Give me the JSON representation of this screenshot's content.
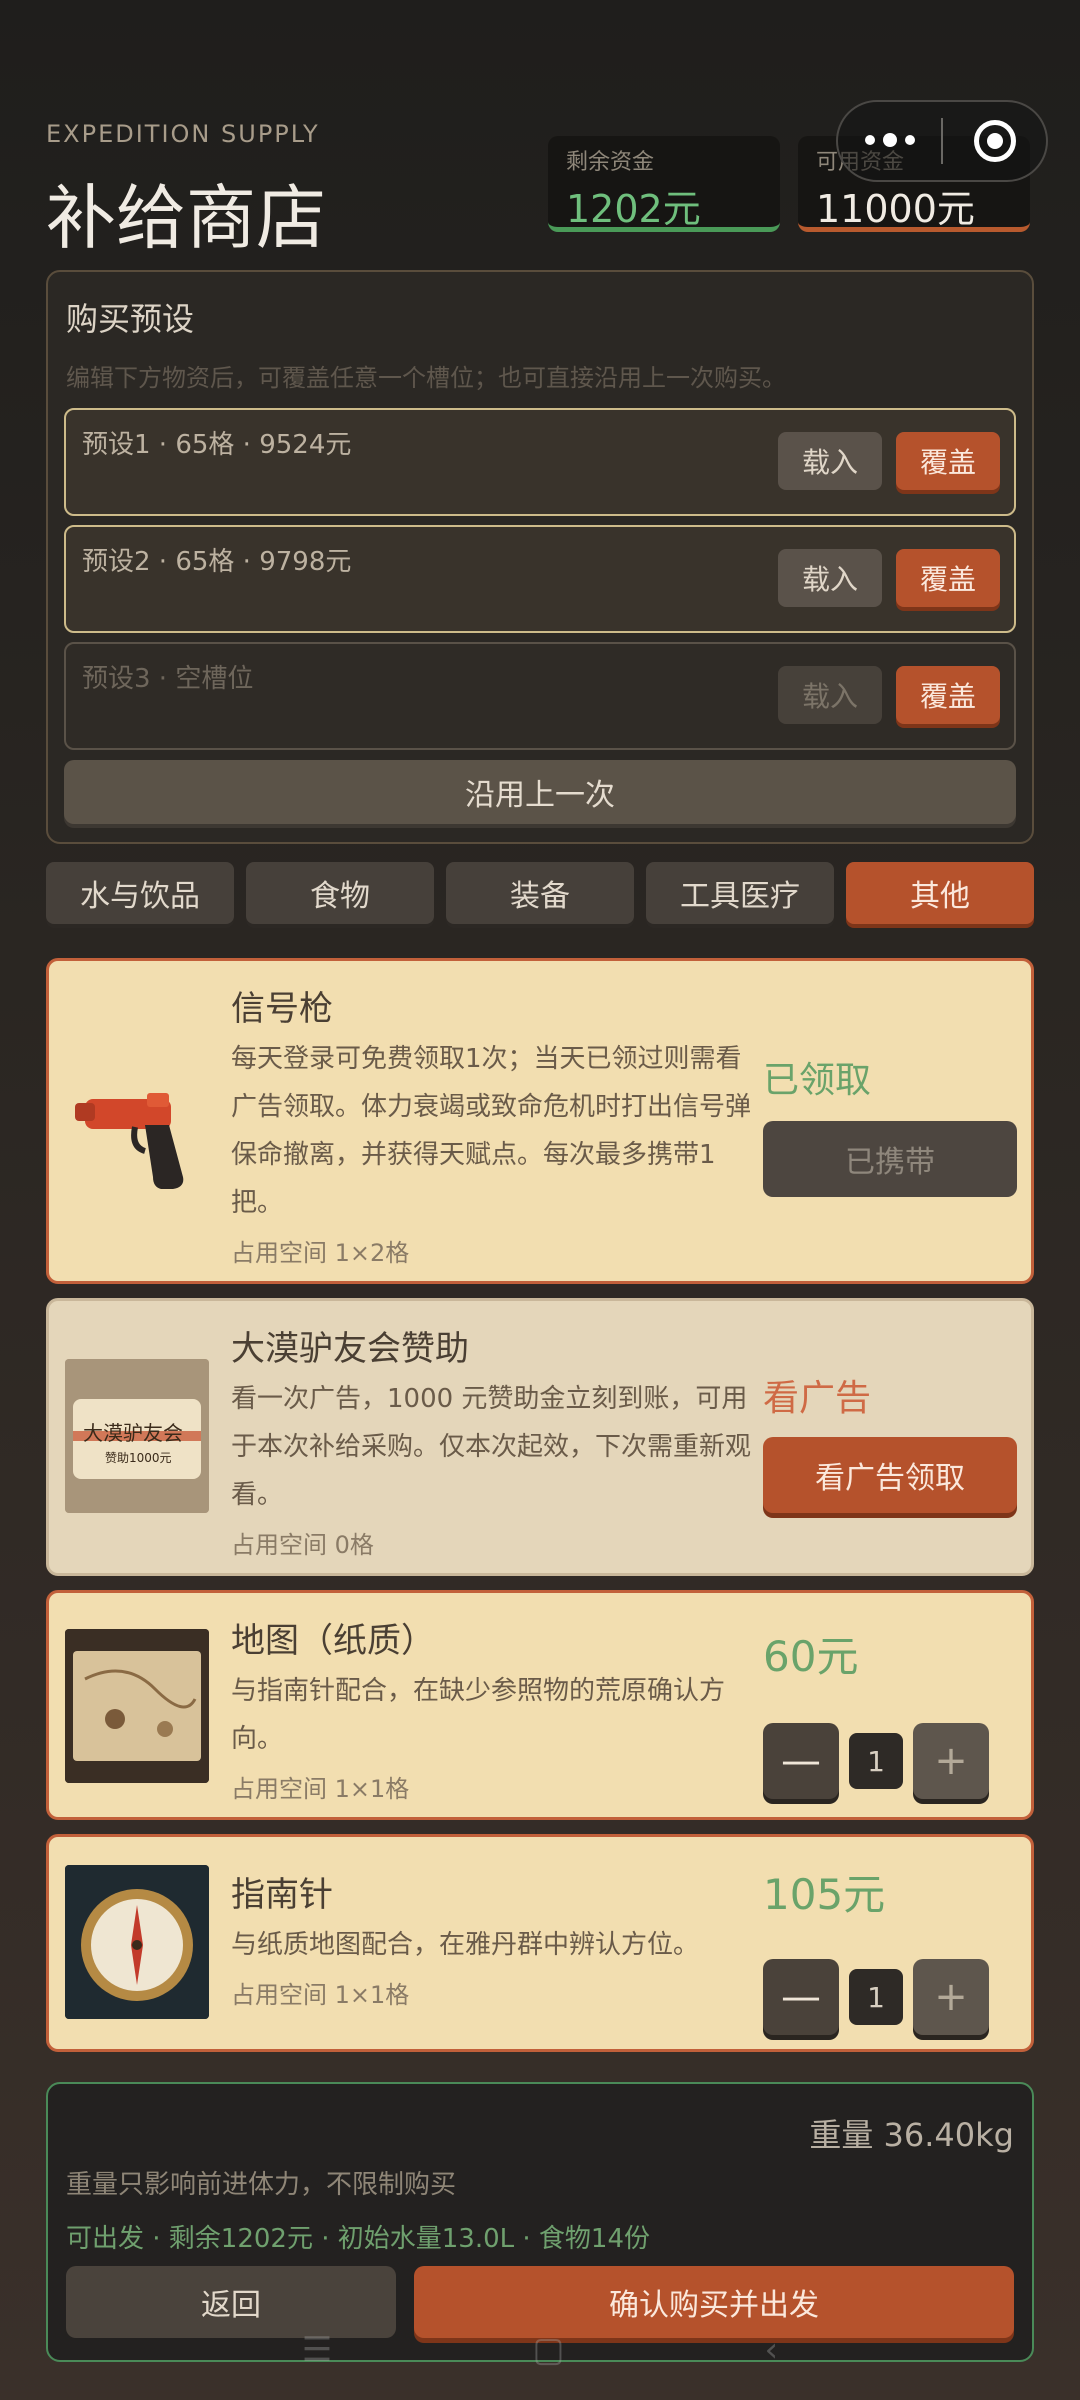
{
  "header": {
    "subtitle": "EXPEDITION SUPPLY",
    "title": "补给商店"
  },
  "funds": {
    "remaining_label": "剩余资金",
    "remaining_value": "1202元",
    "available_label": "可用资金",
    "available_value": "11000元"
  },
  "presets": {
    "title": "购买预设",
    "hint": "编辑下方物资后，可覆盖任意一个槽位；也可直接沿用上一次购买。",
    "slots": [
      {
        "info": "预设1 · 65格 · 9524元",
        "load": "载入",
        "overwrite": "覆盖"
      },
      {
        "info": "预设2 · 65格 · 9798元",
        "load": "载入",
        "overwrite": "覆盖"
      },
      {
        "info": "预设3 · 空槽位",
        "load": "载入",
        "overwrite": "覆盖"
      }
    ],
    "reuse_label": "沿用上一次"
  },
  "tabs": [
    "水与饮品",
    "食物",
    "装备",
    "工具医疗",
    "其他"
  ],
  "items": {
    "flare": {
      "name": "信号枪",
      "desc": "每天登录可免费领取1次；当天已领过则需看广告领取。体力衰竭或致命危机时打出信号弹保命撤离，并获得天赋点。每次最多携带1把。",
      "space": "占用空间 1×2格",
      "status": "已领取",
      "action": "已携带"
    },
    "sponsor": {
      "name": "大漠驴友会赞助",
      "desc": "看一次广告，1000 元赞助金立刻到账，可用于本次补给采购。仅本次起效，下次需重新观看。",
      "space": "占用空间 0格",
      "status": "看广告",
      "action": "看广告领取",
      "thumb_text": "大漠驴友会",
      "thumb_sub": "赞助1000元"
    },
    "map": {
      "name": "地图（纸质）",
      "desc": "与指南针配合，在缺少参照物的荒原确认方向。",
      "space": "占用空间 1×1格",
      "price": "60元",
      "qty": "1"
    },
    "compass": {
      "name": "指南针",
      "desc": "与纸质地图配合，在雅丹群中辨认方位。",
      "space": "占用空间 1×1格",
      "price": "105元",
      "qty": "1"
    }
  },
  "stepper": {
    "minus": "—",
    "plus": "+"
  },
  "summary": {
    "weight": "重量 36.40kg",
    "note": "重量只影响前进体力，不限制购买",
    "stats": "可出发 · 剩余1202元 · 初始水量13.0L · 食物14份",
    "back": "返回",
    "confirm": "确认购买并出发"
  },
  "colors": {
    "accent": "#b5522c",
    "green": "#6fbf7d",
    "card": "#f2deb0"
  }
}
